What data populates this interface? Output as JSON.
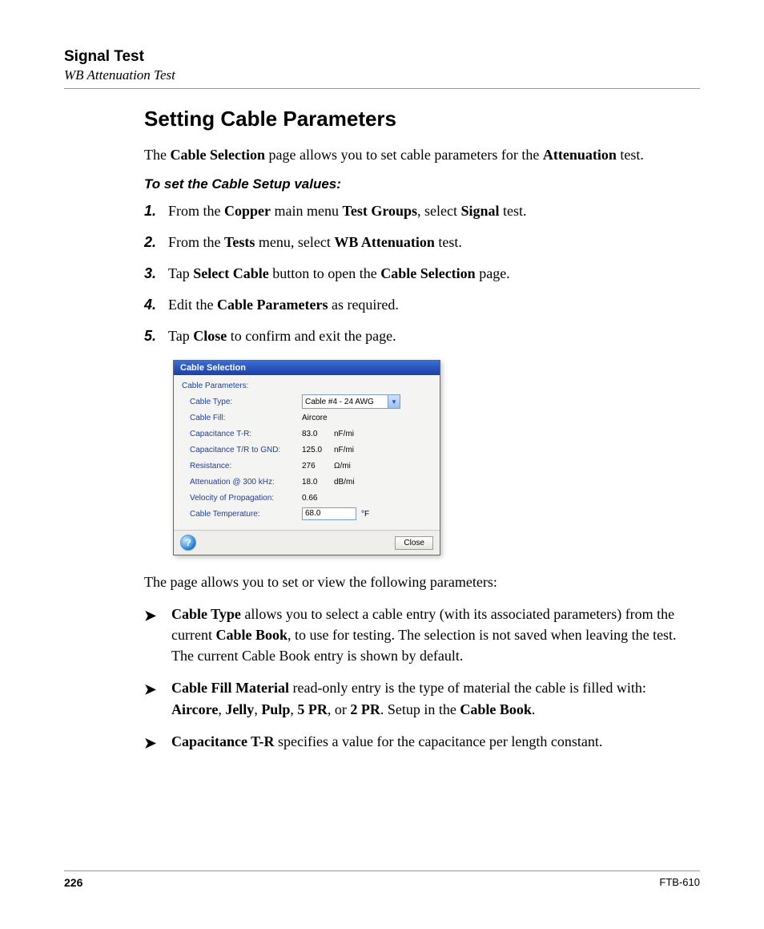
{
  "header": {
    "title": "Signal Test",
    "subtitle": "WB Attenuation Test"
  },
  "heading": "Setting Cable Parameters",
  "intro": {
    "pre": "The ",
    "b1": "Cable Selection",
    "mid": " page allows you to set cable parameters for the ",
    "b2": "Attenuation",
    "post": " test."
  },
  "subhead": "To set the Cable Setup values:",
  "steps": {
    "n1": "1.",
    "s1": {
      "a": "From the ",
      "b1": "Copper",
      "b": " main menu ",
      "b2": "Test Groups",
      "c": ", select ",
      "b3": "Signal",
      "d": " test."
    },
    "n2": "2.",
    "s2": {
      "a": "From the ",
      "b1": "Tests",
      "b": " menu, select ",
      "b2": "WB Attenuation",
      "c": " test."
    },
    "n3": "3.",
    "s3": {
      "a": "Tap ",
      "b1": "Select Cable",
      "b": " button to open the ",
      "b2": "Cable Selection",
      "c": " page."
    },
    "n4": "4.",
    "s4": {
      "a": "Edit the ",
      "b1": "Cable Parameters",
      "b": " as required."
    },
    "n5": "5.",
    "s5": {
      "a": "Tap ",
      "b1": "Close",
      "b": " to confirm and exit the page."
    }
  },
  "dialog": {
    "title": "Cable Selection",
    "group": "Cable Parameters:",
    "rows": {
      "type_label": "Cable Type:",
      "type_value": "Cable #4 - 24 AWG",
      "fill_label": "Cable Fill:",
      "fill_value": "Aircore",
      "cap_tr_label": "Capacitance T-R:",
      "cap_tr_value": "83.0",
      "cap_tr_unit": "nF/mi",
      "cap_gnd_label": "Capacitance T/R to GND:",
      "cap_gnd_value": "125.0",
      "cap_gnd_unit": "nF/mi",
      "res_label": "Resistance:",
      "res_value": "276",
      "res_unit": "Ω/mi",
      "att_label": "Attenuation @ 300 kHz:",
      "att_value": "18.0",
      "att_unit": "dB/mi",
      "vop_label": "Velocity of Propagation:",
      "vop_value": "0.66",
      "temp_label": "Cable Temperature:",
      "temp_value": "68.0",
      "temp_unit": "°F"
    },
    "help_glyph": "?",
    "close": "Close"
  },
  "after_dialog": "The page allows you to set or view the following parameters:",
  "bullets": {
    "b1": {
      "t1": "Cable Type",
      "a": " allows you to select a cable entry (with its associated parameters) from the current ",
      "t2": "Cable Book",
      "b": ", to use for testing. The selection is not saved when leaving the test. The current Cable Book entry is shown by default."
    },
    "b2": {
      "t1": "Cable Fill Material",
      "a": " read-only entry is the type of material the cable is filled with: ",
      "o1": "Aircore",
      "c1": ", ",
      "o2": "Jelly",
      "c2": ", ",
      "o3": "Pulp",
      "c3": ", ",
      "o4": "5 PR",
      "c4": ", or ",
      "o5": "2 PR",
      "b": ". Setup in the ",
      "t2": "Cable Book",
      "c": "."
    },
    "b3": {
      "t1": "Capacitance T-R",
      "a": " specifies a value for the capacitance per length constant."
    }
  },
  "arrow_glyph": "➤",
  "footer": {
    "page": "226",
    "model": "FTB-610"
  }
}
